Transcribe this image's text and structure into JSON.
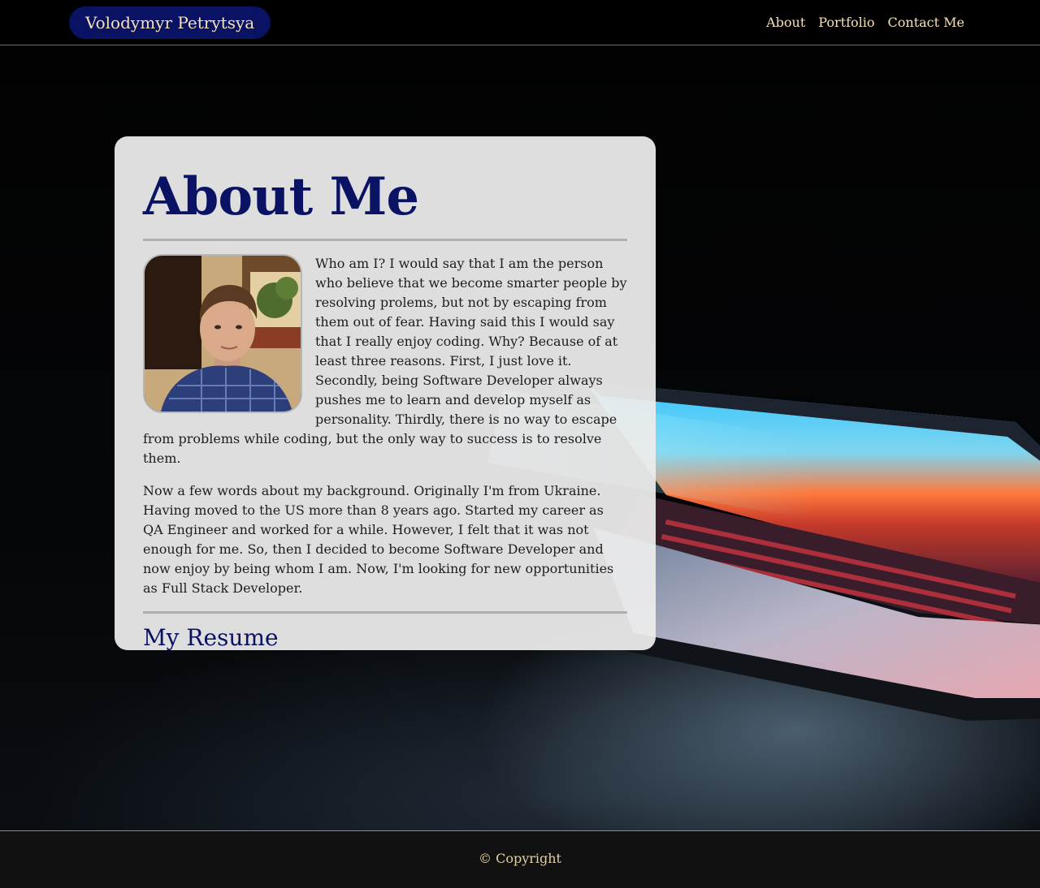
{
  "navbar": {
    "brand": "Volodymyr Petrytsya",
    "links": [
      "About",
      "Portfolio",
      "Contact Me"
    ]
  },
  "about": {
    "title": "About Me",
    "paragraphs": [
      "Who am I? I would say that I am the person who believe that we become smarter people by resolving prolems, but not by escaping from them out of fear. Having said this I would say that I really enjoy coding. Why? Because of at least three reasons. First, I just love it. Secondly, being Software Developer always pushes me to learn and develop myself as personality. Thirdly, there is no way to escape from problems while coding, but the only way to success is to resolve them.",
      "Now a few words about my background. Originally I'm from Ukraine. Having moved to the US more than 8 years ago. Started my career as QA Engineer and worked for a while. However, I felt that it was not enough for me. So, then I decided to become Software Developer and now enjoy by being whom I am. Now, I'm looking for new opportunities as Full Stack Developer."
    ],
    "resume_link": "My Resume"
  },
  "footer": {
    "text": "© Copyright"
  },
  "colors": {
    "brand_bg": "#0a1263",
    "nav_text": "#f6e2b3",
    "heading": "#0a1263",
    "card_bg": "#ececec"
  }
}
